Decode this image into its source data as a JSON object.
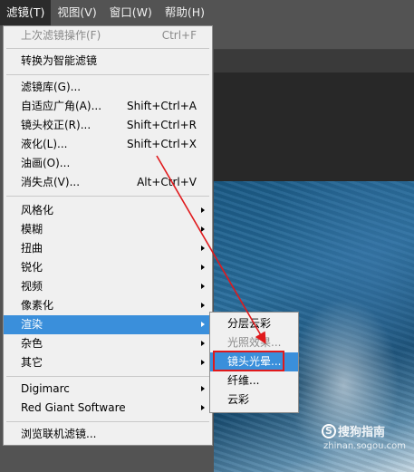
{
  "menubar": {
    "items": [
      "滤镜(T)",
      "视图(V)",
      "窗口(W)",
      "帮助(H)"
    ]
  },
  "filter_menu": {
    "last_filter": {
      "label": "上次滤镜操作(F)",
      "shortcut": "Ctrl+F"
    },
    "convert_smart": {
      "label": "转换为智能滤镜"
    },
    "gallery": {
      "label": "滤镜库(G)..."
    },
    "adaptive_wide": {
      "label": "自适应广角(A)...",
      "shortcut": "Shift+Ctrl+A"
    },
    "lens_correction": {
      "label": "镜头校正(R)...",
      "shortcut": "Shift+Ctrl+R"
    },
    "liquify": {
      "label": "液化(L)...",
      "shortcut": "Shift+Ctrl+X"
    },
    "oil_paint": {
      "label": "油画(O)..."
    },
    "vanishing_point": {
      "label": "消失点(V)...",
      "shortcut": "Alt+Ctrl+V"
    },
    "stylize": {
      "label": "风格化"
    },
    "blur": {
      "label": "模糊"
    },
    "distort": {
      "label": "扭曲"
    },
    "sharpen": {
      "label": "锐化"
    },
    "video": {
      "label": "视频"
    },
    "pixelate": {
      "label": "像素化"
    },
    "render": {
      "label": "渲染"
    },
    "noise": {
      "label": "杂色"
    },
    "other": {
      "label": "其它"
    },
    "digimarc": {
      "label": "Digimarc"
    },
    "red_giant": {
      "label": "Red Giant Software"
    },
    "browse_online": {
      "label": "浏览联机滤镜..."
    }
  },
  "render_submenu": {
    "items": [
      "分层云彩",
      "光照效果...",
      "镜头光晕...",
      "纤维...",
      "云彩"
    ]
  },
  "watermark": {
    "logo": "S",
    "name": "搜狗指南",
    "url": "zhinan.sogou.com"
  },
  "colors": {
    "highlight": "#3a8fdb",
    "annotation_red": "#e0191c"
  }
}
